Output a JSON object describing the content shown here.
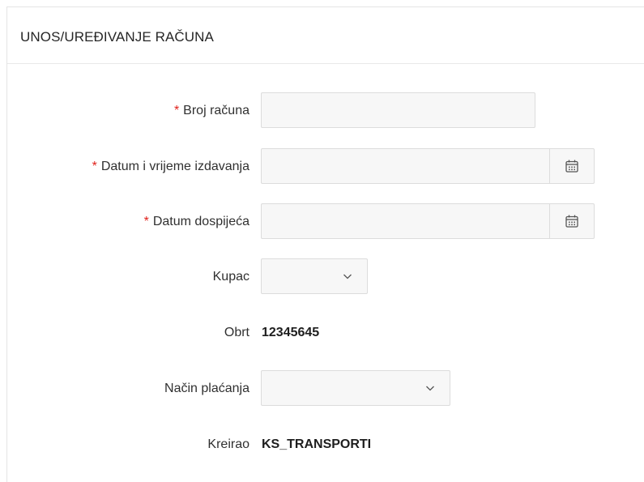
{
  "form": {
    "title": "UNOS/UREĐIVANJE RAČUNA",
    "required_marker": "*",
    "fields": {
      "broj_racuna": {
        "label": "Broj računa",
        "value": "",
        "required": true
      },
      "datum_izdavanja": {
        "label": "Datum i vrijeme izdavanja",
        "value": "",
        "required": true,
        "icon": "calendar-icon"
      },
      "datum_dospijeca": {
        "label": "Datum dospijeća",
        "value": "",
        "required": true,
        "icon": "calendar-icon"
      },
      "kupac": {
        "label": "Kupac",
        "selected": "",
        "icon": "chevron-down-icon"
      },
      "obrt": {
        "label": "Obrt",
        "value": "12345645"
      },
      "nacin_placanja": {
        "label": "Način plaćanja",
        "selected": "",
        "icon": "chevron-down-icon"
      },
      "kreirao": {
        "label": "Kreirao",
        "value": "KS_TRANSPORTI"
      }
    }
  },
  "colors": {
    "required": "#e0211b",
    "input_bg": "#f7f7f7",
    "border": "#dcdcdc"
  }
}
